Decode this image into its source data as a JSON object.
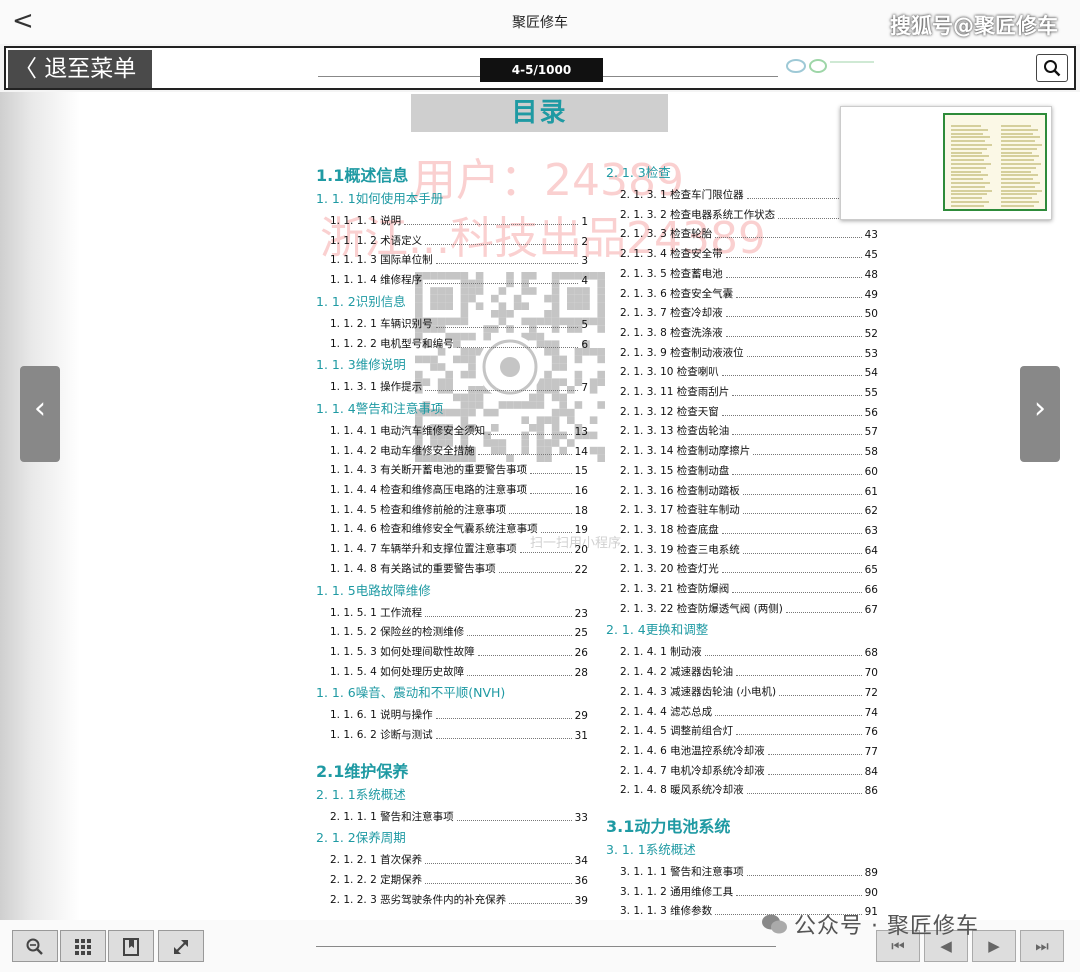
{
  "app": {
    "back_glyph": "<",
    "title": "聚匠修车",
    "watermark": "搜狐号@聚匠修车"
  },
  "toolbar": {
    "exit_label": "〈 退至菜单",
    "page_indicator": "4-5/1000"
  },
  "page": {
    "heading": "目录",
    "wm_user": "用户：24389",
    "wm_brand": "浙江...科技出品24389",
    "qr_caption": "扫一扫用小程序",
    "left_column": [
      {
        "t": "h1",
        "text": "1.1概述信息"
      },
      {
        "t": "h2",
        "text": "1. 1. 1如何使用本手册"
      },
      {
        "t": "e",
        "label": "1. 1. 1. 1 说明",
        "page": "1"
      },
      {
        "t": "e",
        "label": "1. 1. 1. 2 术语定义",
        "page": "2"
      },
      {
        "t": "e",
        "label": "1. 1. 1. 3 国际单位制",
        "page": "3"
      },
      {
        "t": "e",
        "label": "1. 1. 1. 4 维修程序",
        "page": "4"
      },
      {
        "t": "h2",
        "text": "1. 1. 2识别信息"
      },
      {
        "t": "e",
        "label": "1. 1. 2. 1 车辆识别号",
        "page": "5"
      },
      {
        "t": "e",
        "label": "1. 1. 2. 2 电机型号和编号",
        "page": "6"
      },
      {
        "t": "h2",
        "text": "1. 1. 3维修说明"
      },
      {
        "t": "e",
        "label": "1. 1. 3. 1 操作提示",
        "page": "7"
      },
      {
        "t": "h2",
        "text": "1. 1. 4警告和注意事项"
      },
      {
        "t": "e",
        "label": "1. 1. 4. 1 电动汽车维修安全须知",
        "page": "13"
      },
      {
        "t": "e",
        "label": "1. 1. 4. 2 电动车维修安全措施",
        "page": "14"
      },
      {
        "t": "e",
        "label": "1. 1. 4. 3 有关断开蓄电池的重要警告事项",
        "page": "15"
      },
      {
        "t": "e",
        "label": "1. 1. 4. 4 检查和维修高压电路的注意事项",
        "page": "16"
      },
      {
        "t": "e",
        "label": "1. 1. 4. 5 检查和维修前舱的注意事项",
        "page": "18"
      },
      {
        "t": "e",
        "label": "1. 1. 4. 6 检查和维修安全气囊系统注意事项",
        "page": "19"
      },
      {
        "t": "e",
        "label": "1. 1. 4. 7 车辆举升和支撑位置注意事项",
        "page": "20"
      },
      {
        "t": "e",
        "label": "1. 1. 4. 8 有关路试的重要警告事项",
        "page": "22"
      },
      {
        "t": "h2",
        "text": "1. 1. 5电路故障维修"
      },
      {
        "t": "e",
        "label": "1. 1. 5. 1 工作流程",
        "page": "23"
      },
      {
        "t": "e",
        "label": "1. 1. 5. 2 保险丝的检测维修",
        "page": "25"
      },
      {
        "t": "e",
        "label": "1. 1. 5. 3 如何处理间歇性故障",
        "page": "26"
      },
      {
        "t": "e",
        "label": "1. 1. 5. 4 如何处理历史故障",
        "page": "28"
      },
      {
        "t": "h2",
        "text": "1. 1. 6噪音、震动和不平顺(NVH)"
      },
      {
        "t": "e",
        "label": "1. 1. 6. 1 说明与操作",
        "page": "29"
      },
      {
        "t": "e",
        "label": "1. 1. 6. 2 诊断与测试",
        "page": "31"
      },
      {
        "t": "h1",
        "text": "2.1维护保养"
      },
      {
        "t": "h2",
        "text": "2. 1. 1系统概述"
      },
      {
        "t": "e",
        "label": "2. 1. 1. 1 警告和注意事项",
        "page": "33"
      },
      {
        "t": "h2",
        "text": "2. 1. 2保养周期"
      },
      {
        "t": "e",
        "label": "2. 1. 2. 1 首次保养",
        "page": "34"
      },
      {
        "t": "e",
        "label": "2. 1. 2. 2 定期保养",
        "page": "36"
      },
      {
        "t": "e",
        "label": "2. 1. 2. 3 恶劣驾驶条件内的补充保养",
        "page": "39"
      }
    ],
    "right_column": [
      {
        "t": "h2",
        "text": "2. 1. 3检查"
      },
      {
        "t": "e",
        "label": "2. 1. 3. 1 检查车门限位器",
        "page": ""
      },
      {
        "t": "e",
        "label": "2. 1. 3. 2 检查电器系统工作状态",
        "page": ""
      },
      {
        "t": "e",
        "label": "2. 1. 3. 3 检查轮胎",
        "page": "43"
      },
      {
        "t": "e",
        "label": "2. 1. 3. 4 检查安全带",
        "page": "45"
      },
      {
        "t": "e",
        "label": "2. 1. 3. 5 检查蓄电池",
        "page": "48"
      },
      {
        "t": "e",
        "label": "2. 1. 3. 6 检查安全气囊",
        "page": "49"
      },
      {
        "t": "e",
        "label": "2. 1. 3. 7 检查冷却液",
        "page": "50"
      },
      {
        "t": "e",
        "label": "2. 1. 3. 8 检查洗涤液",
        "page": "52"
      },
      {
        "t": "e",
        "label": "2. 1. 3. 9 检查制动液液位",
        "page": "53"
      },
      {
        "t": "e",
        "label": "2. 1. 3. 10 检查喇叭",
        "page": "54"
      },
      {
        "t": "e",
        "label": "2. 1. 3. 11 检查雨刮片",
        "page": "55"
      },
      {
        "t": "e",
        "label": "2. 1. 3. 12 检查天窗",
        "page": "56"
      },
      {
        "t": "e",
        "label": "2. 1. 3. 13 检查齿轮油",
        "page": "57"
      },
      {
        "t": "e",
        "label": "2. 1. 3. 14 检查制动摩擦片",
        "page": "58"
      },
      {
        "t": "e",
        "label": "2. 1. 3. 15 检查制动盘",
        "page": "60"
      },
      {
        "t": "e",
        "label": "2. 1. 3. 16 检查制动踏板",
        "page": "61"
      },
      {
        "t": "e",
        "label": "2. 1. 3. 17 检查驻车制动",
        "page": "62"
      },
      {
        "t": "e",
        "label": "2. 1. 3. 18 检查底盘",
        "page": "63"
      },
      {
        "t": "e",
        "label": "2. 1. 3. 19 检查三电系统",
        "page": "64"
      },
      {
        "t": "e",
        "label": "2. 1. 3. 20 检查灯光",
        "page": "65"
      },
      {
        "t": "e",
        "label": "2. 1. 3. 21 检查防爆阀",
        "page": "66"
      },
      {
        "t": "e",
        "label": "2. 1. 3. 22 检查防爆透气阀 (两侧)",
        "page": "67"
      },
      {
        "t": "h2",
        "text": "2. 1. 4更换和调整"
      },
      {
        "t": "e",
        "label": "2. 1. 4. 1 制动液",
        "page": "68"
      },
      {
        "t": "e",
        "label": "2. 1. 4. 2 减速器齿轮油",
        "page": "70"
      },
      {
        "t": "e",
        "label": "2. 1. 4. 3 减速器齿轮油 (小电机)",
        "page": "72"
      },
      {
        "t": "e",
        "label": "2. 1. 4. 4 滤芯总成",
        "page": "74"
      },
      {
        "t": "e",
        "label": "2. 1. 4. 5 调整前组合灯",
        "page": "76"
      },
      {
        "t": "e",
        "label": "2. 1. 4. 6 电池温控系统冷却液",
        "page": "77"
      },
      {
        "t": "e",
        "label": "2. 1. 4. 7 电机冷却系统冷却液",
        "page": "84"
      },
      {
        "t": "e",
        "label": "2. 1. 4. 8 暖风系统冷却液",
        "page": "86"
      },
      {
        "t": "h1",
        "text": "3.1动力电池系统"
      },
      {
        "t": "h2",
        "text": "3. 1. 1系统概述"
      },
      {
        "t": "e",
        "label": "3. 1. 1. 1 警告和注意事项",
        "page": "89"
      },
      {
        "t": "e",
        "label": "3. 1. 1. 2 通用维修工具",
        "page": "90"
      },
      {
        "t": "e",
        "label": "3. 1. 1. 3 维修参数",
        "page": "91"
      }
    ]
  },
  "nav": {
    "prev_glyph": "‹",
    "next_glyph": "›"
  },
  "bottom": {
    "right_buttons": [
      "⏮",
      "◀",
      "▶",
      "⏭"
    ],
    "wechat_text": "公众号 · 聚匠修车"
  },
  "colors": {
    "accent": "#1f9aa3",
    "toolbar_button": "#4a4a4a",
    "thumb_frame": "#2e8b3a"
  }
}
